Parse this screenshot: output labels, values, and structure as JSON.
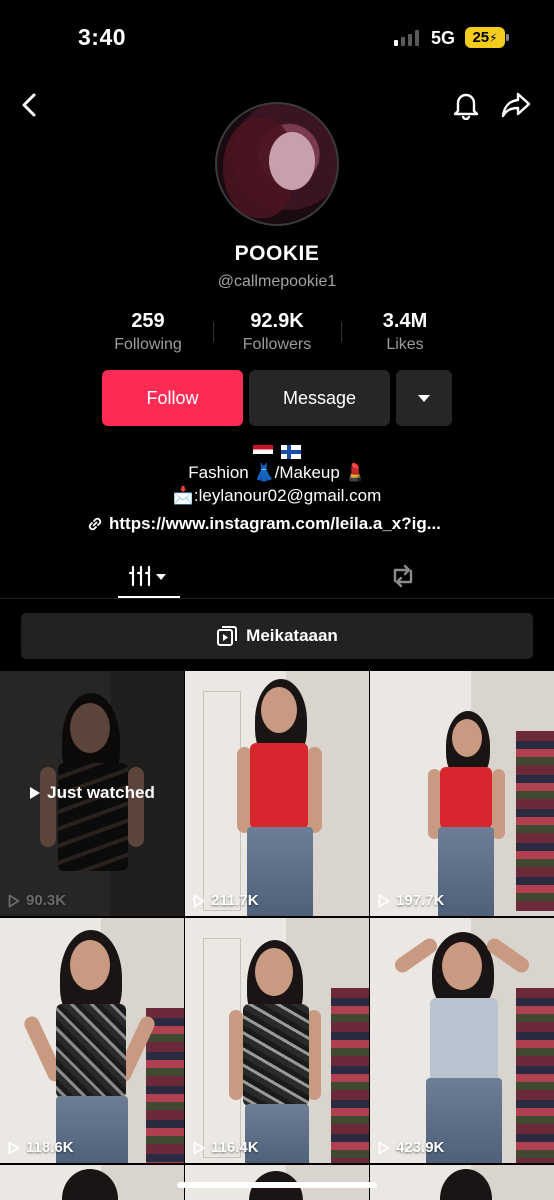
{
  "status_bar": {
    "time": "3:40",
    "network": "5G",
    "battery": "25"
  },
  "profile": {
    "name": "POOKIE",
    "handle": "@callmepookie1",
    "stats": [
      {
        "value": "259",
        "label": "Following"
      },
      {
        "value": "92.9K",
        "label": "Followers"
      },
      {
        "value": "3.4M",
        "label": "Likes"
      }
    ],
    "buttons": {
      "follow": "Follow",
      "message": "Message"
    },
    "bio": {
      "flags": [
        "flag-egypt",
        "flag-finland"
      ],
      "line1": "Fashion 👗/Makeup 💄",
      "line2": "📩:leylanour02@gmail.com",
      "link": "https://www.instagram.com/leila.a_x?ig..."
    }
  },
  "tabs": {
    "active": "videos",
    "items": [
      "videos-grid-icon",
      "repost-icon"
    ]
  },
  "playlist": {
    "label": "Meikataaan"
  },
  "videos": [
    {
      "views": "90.3K",
      "badge": "Just watched",
      "top_color": "#2a2a2a"
    },
    {
      "views": "211.7K",
      "top_color": "#d9262e"
    },
    {
      "views": "197.7K",
      "top_color": "#d9262e"
    },
    {
      "views": "118.6K",
      "top_color": "#3a3a3a"
    },
    {
      "views": "116.4K",
      "top_color": "#3a3a3a"
    },
    {
      "views": "423.9K",
      "top_color": "#b9c2cf"
    }
  ],
  "colors": {
    "accent": "#fe2c55",
    "surface": "#262626",
    "background": "#000000"
  }
}
